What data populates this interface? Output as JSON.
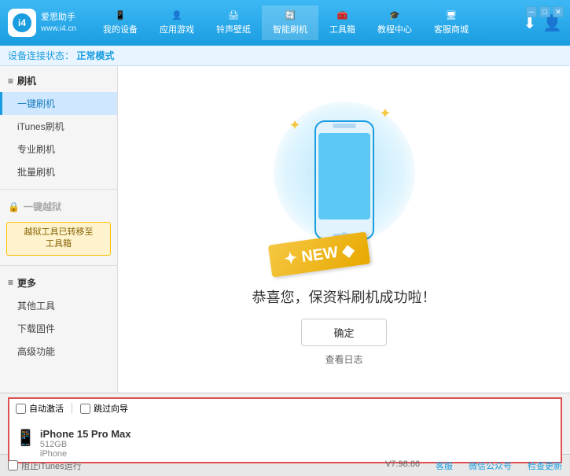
{
  "app": {
    "logo_line1": "爱思助手",
    "logo_line2": "www.i4.cn"
  },
  "nav": {
    "items": [
      {
        "label": "我的设备",
        "icon": "📱"
      },
      {
        "label": "应用游戏",
        "icon": "👤"
      },
      {
        "label": "铃声壁纸",
        "icon": "🖨"
      },
      {
        "label": "智能刷机",
        "icon": "🔄"
      },
      {
        "label": "工具箱",
        "icon": "🧰"
      },
      {
        "label": "教程中心",
        "icon": "🎓"
      },
      {
        "label": "客服商城",
        "icon": "🖥"
      }
    ]
  },
  "subheader": {
    "prefix": "设备连接状态：",
    "status": "正常模式"
  },
  "sidebar": {
    "sections": [
      {
        "header": "刷机",
        "items": [
          {
            "label": "一键刷机",
            "active": true
          },
          {
            "label": "iTunes刷机"
          },
          {
            "label": "专业刷机"
          },
          {
            "label": "批量刷机"
          }
        ]
      },
      {
        "header": "一键越狱",
        "disabled": true,
        "notice": "越狱工具已转移至工具箱"
      },
      {
        "header": "更多",
        "items": [
          {
            "label": "其他工具"
          },
          {
            "label": "下载固件"
          },
          {
            "label": "高级功能"
          }
        ]
      }
    ]
  },
  "content": {
    "new_label": "NEW",
    "success_text": "恭喜您，保资料刷机成功啦！",
    "confirm_button": "确定",
    "log_link": "查看日志"
  },
  "device_bar": {
    "auto_activate": "自动激活",
    "auto_guide": "跳过向导",
    "device_name": "iPhone 15 Pro Max",
    "storage": "512GB",
    "type": "iPhone"
  },
  "statusbar": {
    "itunes": "阻止iTunes运行",
    "version": "V7.98.66",
    "tab1": "客服",
    "tab2": "微信公众号",
    "tab3": "检查更新"
  }
}
